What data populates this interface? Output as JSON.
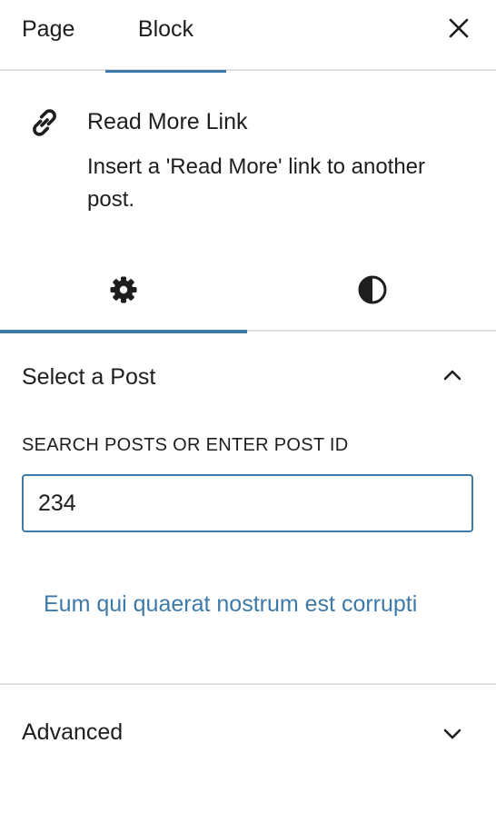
{
  "top_tabs": [
    {
      "label": "Page",
      "active": false
    },
    {
      "label": "Block",
      "active": true
    }
  ],
  "close_icon": "close-icon",
  "block_card": {
    "icon": "link-icon",
    "title": "Read More Link",
    "description": "Insert a 'Read More' link to another post."
  },
  "inspector_tabs": [
    {
      "icon": "gear-icon",
      "name": "Settings",
      "active": true
    },
    {
      "icon": "contrast-icon",
      "name": "Styles",
      "active": false
    }
  ],
  "select_post_panel": {
    "title": "Select a Post",
    "expanded": true,
    "chevron": "chevron-up-icon",
    "field_label": "SEARCH POSTS OR ENTER POST ID",
    "field_value": "234",
    "selected_post_title": "Eum qui quaerat nostrum est corrupti"
  },
  "advanced_panel": {
    "title": "Advanced",
    "expanded": false,
    "chevron": "chevron-down-icon"
  },
  "colors": {
    "accent": "#3d7aa8",
    "text": "#1e1e1e",
    "divider": "#e0e0e0"
  }
}
